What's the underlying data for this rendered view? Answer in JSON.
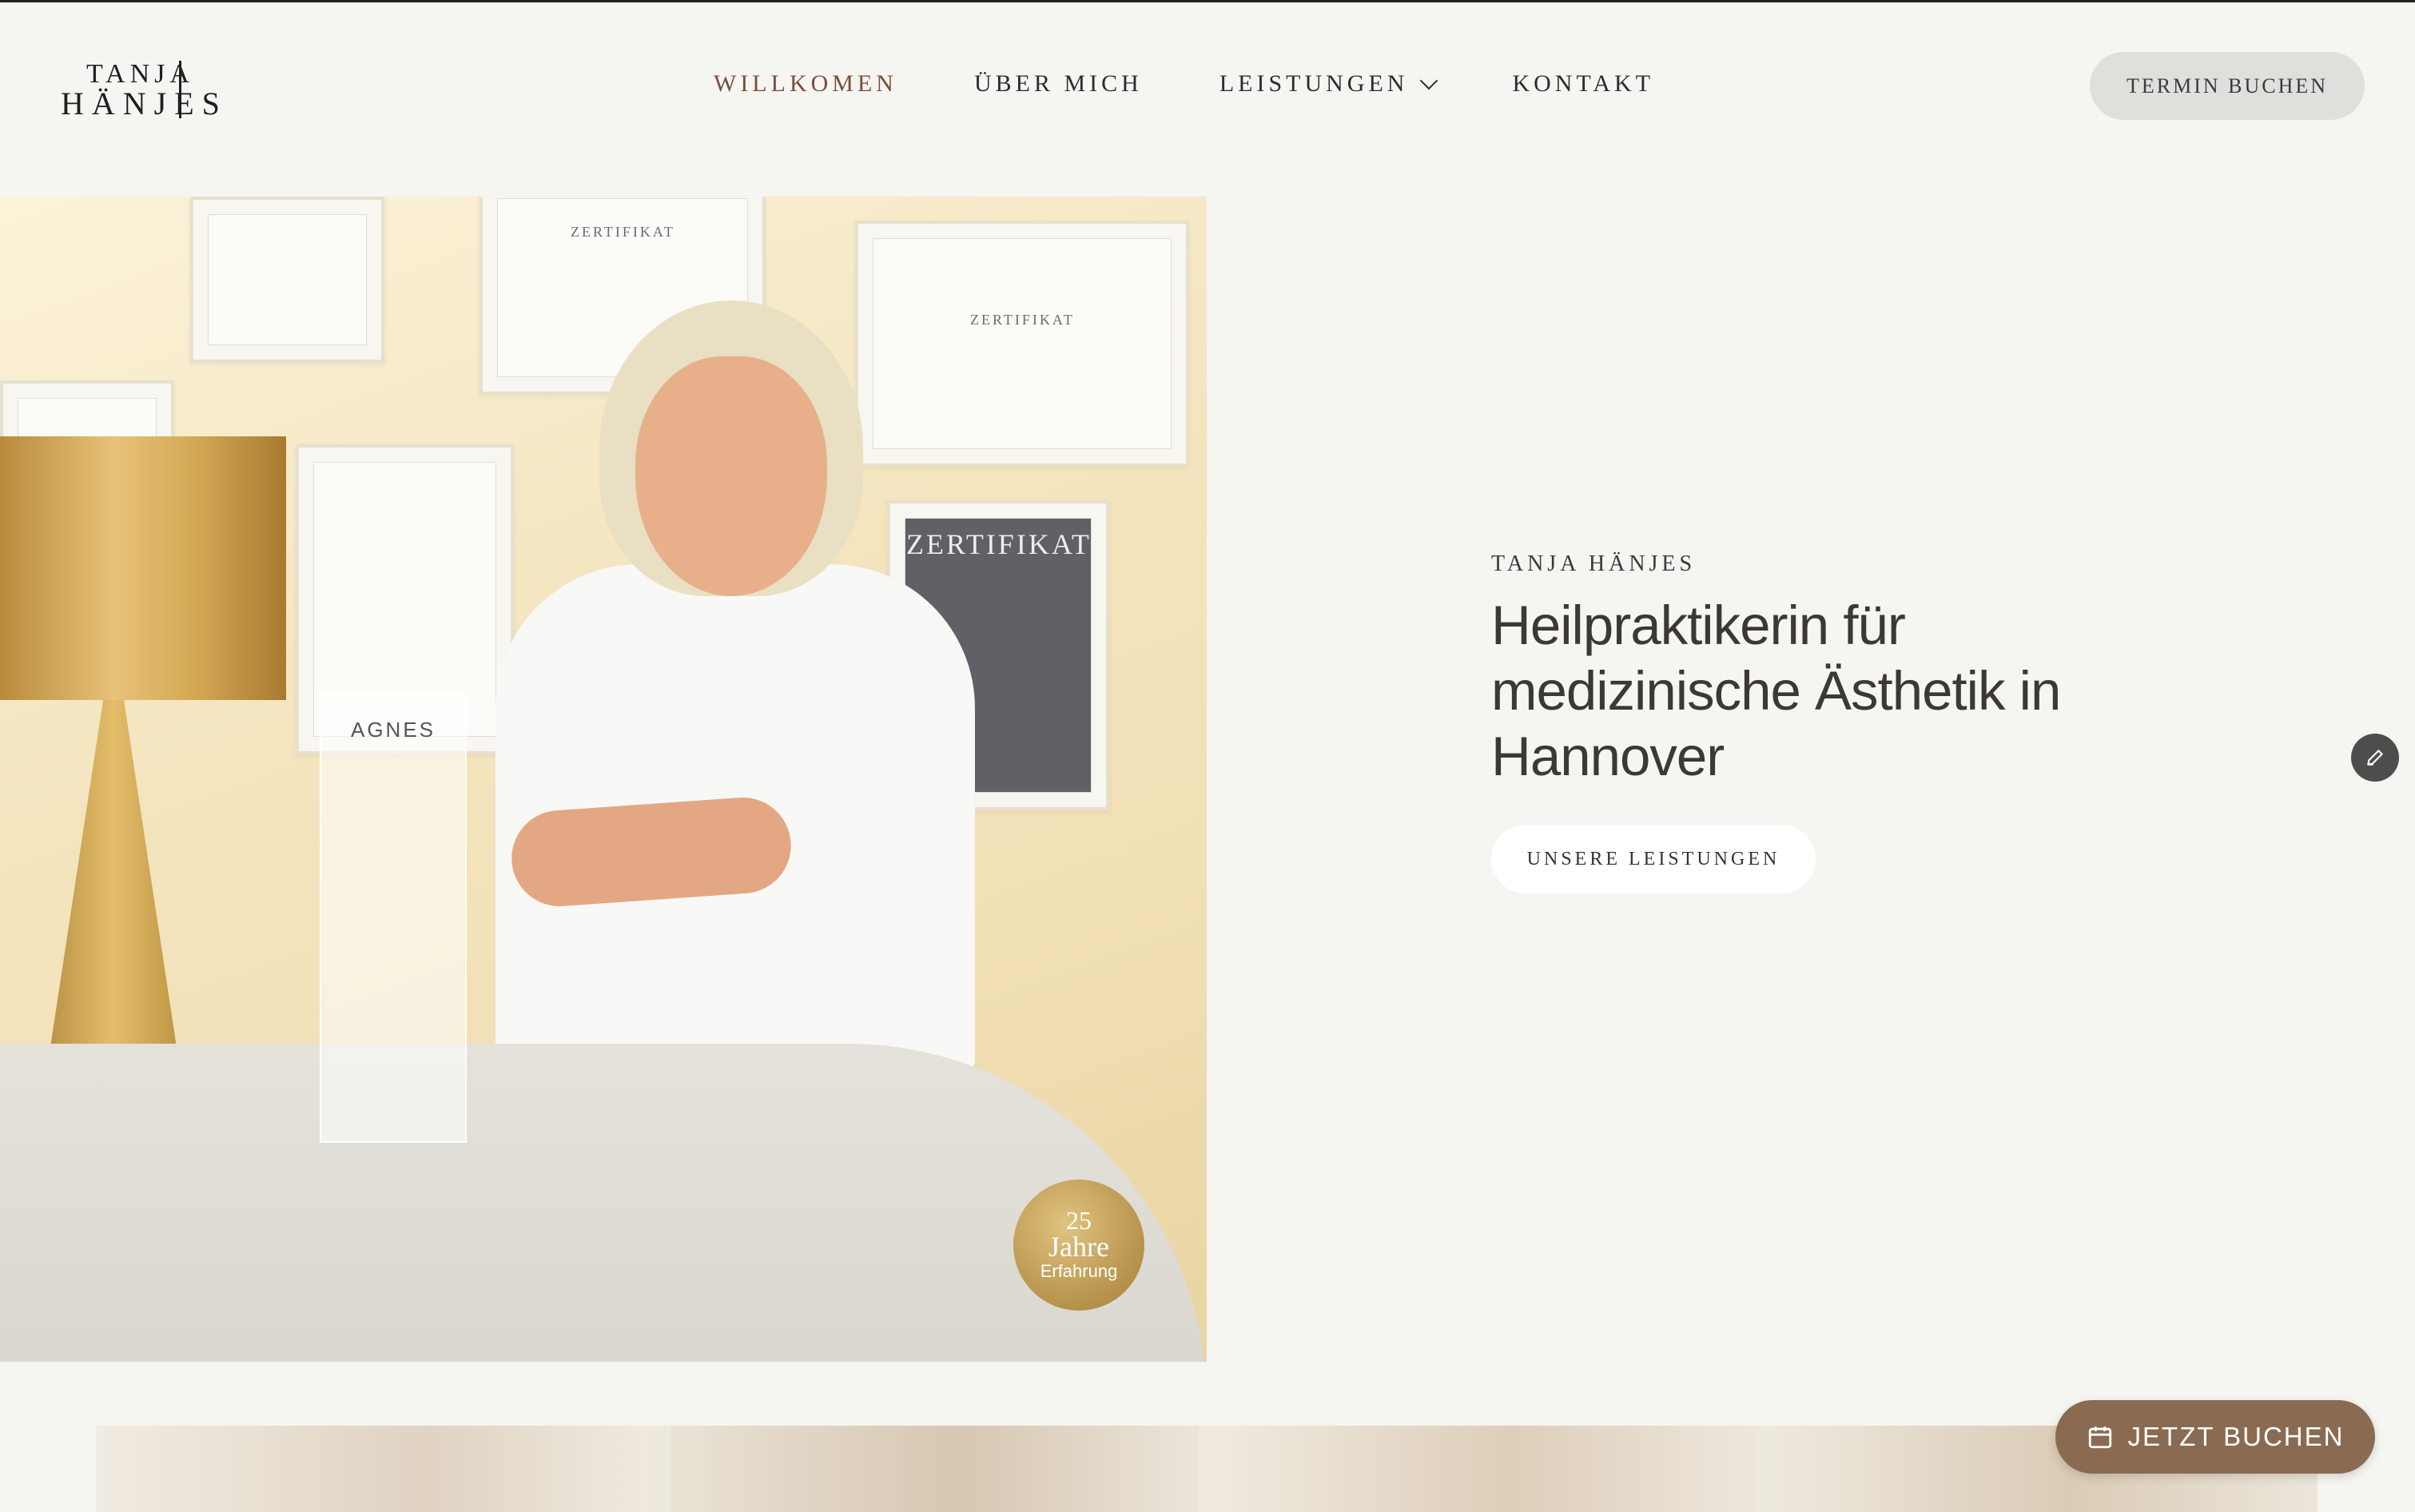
{
  "header": {
    "logo": {
      "line1": "TANJA",
      "line2": "HÄNJES"
    },
    "nav": [
      {
        "label": "WILLKOMEN",
        "active": true
      },
      {
        "label": "ÜBER MICH",
        "active": false
      },
      {
        "label": "LEISTUNGEN",
        "active": false,
        "has_dropdown": true
      },
      {
        "label": "KONTAKT",
        "active": false
      }
    ],
    "book_button": "TERMIN BUCHEN"
  },
  "hero": {
    "kicker": "TANJA HÄNJES",
    "headline": "Heilpraktikerin für medizinische Ästhetik in Hannover",
    "cta_label": "UNSERE LEISTUNGEN",
    "image": {
      "cert_label_1": "ZERTIFIKAT",
      "cert_label_2": "ZERTIFIKAT",
      "cert_label_3": "ZERTIFIKAT",
      "card_brand": "AGNES"
    },
    "badge": {
      "number": "25",
      "unit": "Jahre",
      "caption": "Erfahrung"
    }
  },
  "floating": {
    "book_now": "JETZT BUCHEN"
  },
  "colors": {
    "background": "#f5f5f1",
    "accent_nav_active": "#7a4e3a",
    "book_now_button": "#8a6b52",
    "termin_button": "#dfe0db",
    "badge_gold": "#b6924b"
  },
  "icons": [
    "chevron-down-icon",
    "edit-pencil-icon",
    "calendar-icon"
  ]
}
